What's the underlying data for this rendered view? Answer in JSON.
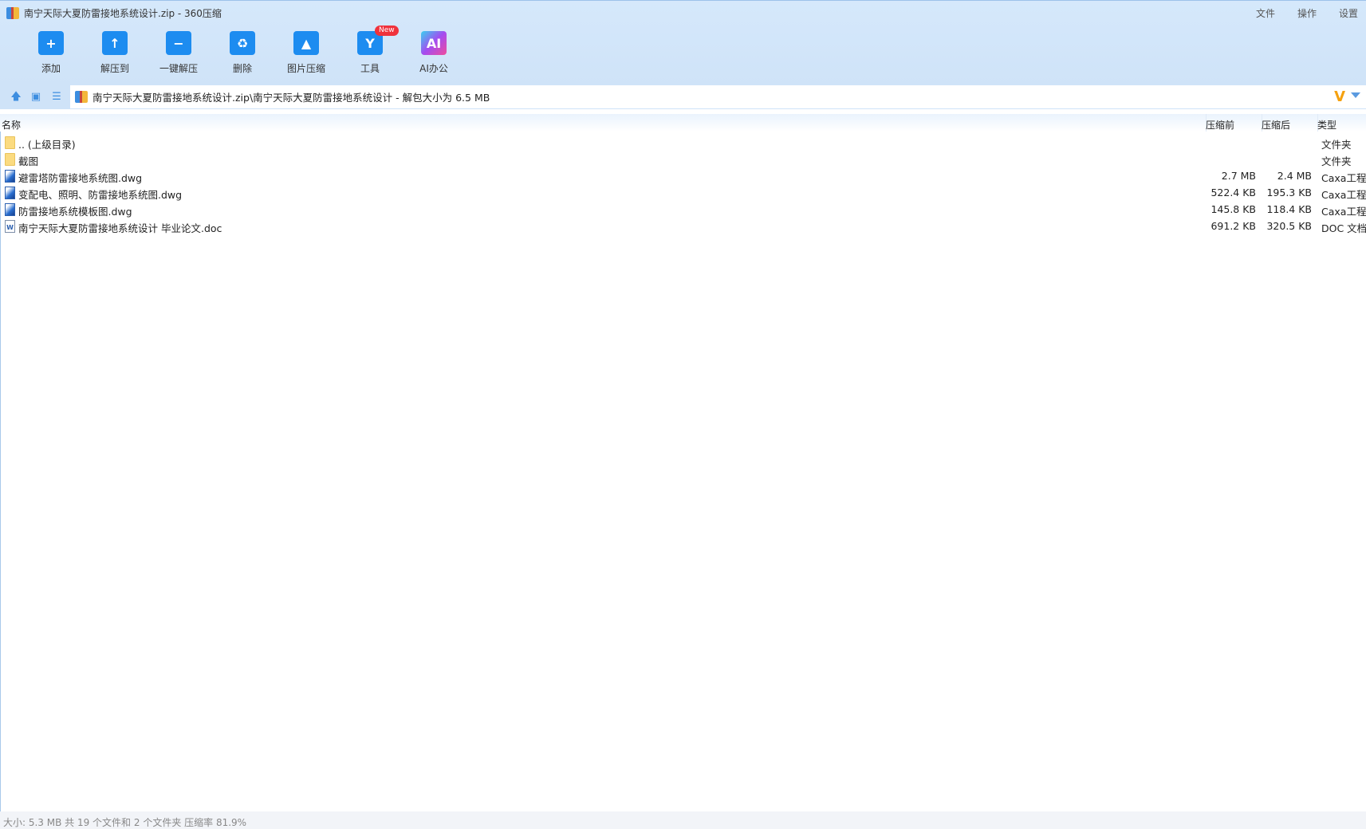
{
  "window": {
    "title": "南宁天际大夏防雷接地系统设计.zip - 360压缩",
    "menu": [
      "文件",
      "操作",
      "设置"
    ]
  },
  "toolbar": [
    {
      "label": "添加",
      "glyph": "+"
    },
    {
      "label": "解压到",
      "glyph": "↑"
    },
    {
      "label": "一键解压",
      "glyph": "−"
    },
    {
      "label": "删除",
      "glyph": "♻"
    },
    {
      "label": "图片压缩",
      "glyph": "▲"
    },
    {
      "label": "工具",
      "glyph": "Y",
      "badge": "New"
    },
    {
      "label": "AI办公",
      "glyph": "AI"
    }
  ],
  "address": {
    "path": "南宁天际大夏防雷接地系统设计.zip\\南宁天际大夏防雷接地系统设计 - 解包大小为 6.5 MB"
  },
  "columns": {
    "name": "名称",
    "before": "压缩前",
    "after": "压缩后",
    "type": "类型"
  },
  "files": [
    {
      "name": ".. (上级目录)",
      "before": "",
      "after": "",
      "type": "文件夹",
      "icon": "folder"
    },
    {
      "name": "截图",
      "before": "",
      "after": "",
      "type": "文件夹",
      "icon": "folder"
    },
    {
      "name": "避雷塔防雷接地系统图.dwg",
      "before": "2.7 MB",
      "after": "2.4 MB",
      "type": "Caxa工程图",
      "icon": "dwg"
    },
    {
      "name": "变配电、照明、防雷接地系统图.dwg",
      "before": "522.4 KB",
      "after": "195.3 KB",
      "type": "Caxa工程图",
      "icon": "dwg"
    },
    {
      "name": "防雷接地系统模板图.dwg",
      "before": "145.8 KB",
      "after": "118.4 KB",
      "type": "Caxa工程图",
      "icon": "dwg"
    },
    {
      "name": "南宁天际大夏防雷接地系统设计 毕业论文.doc",
      "before": "691.2 KB",
      "after": "320.5 KB",
      "type": "DOC 文档",
      "icon": "doc"
    }
  ],
  "status": "大小: 5.3 MB 共 19 个文件和 2 个文件夹 压缩率 81.9%"
}
